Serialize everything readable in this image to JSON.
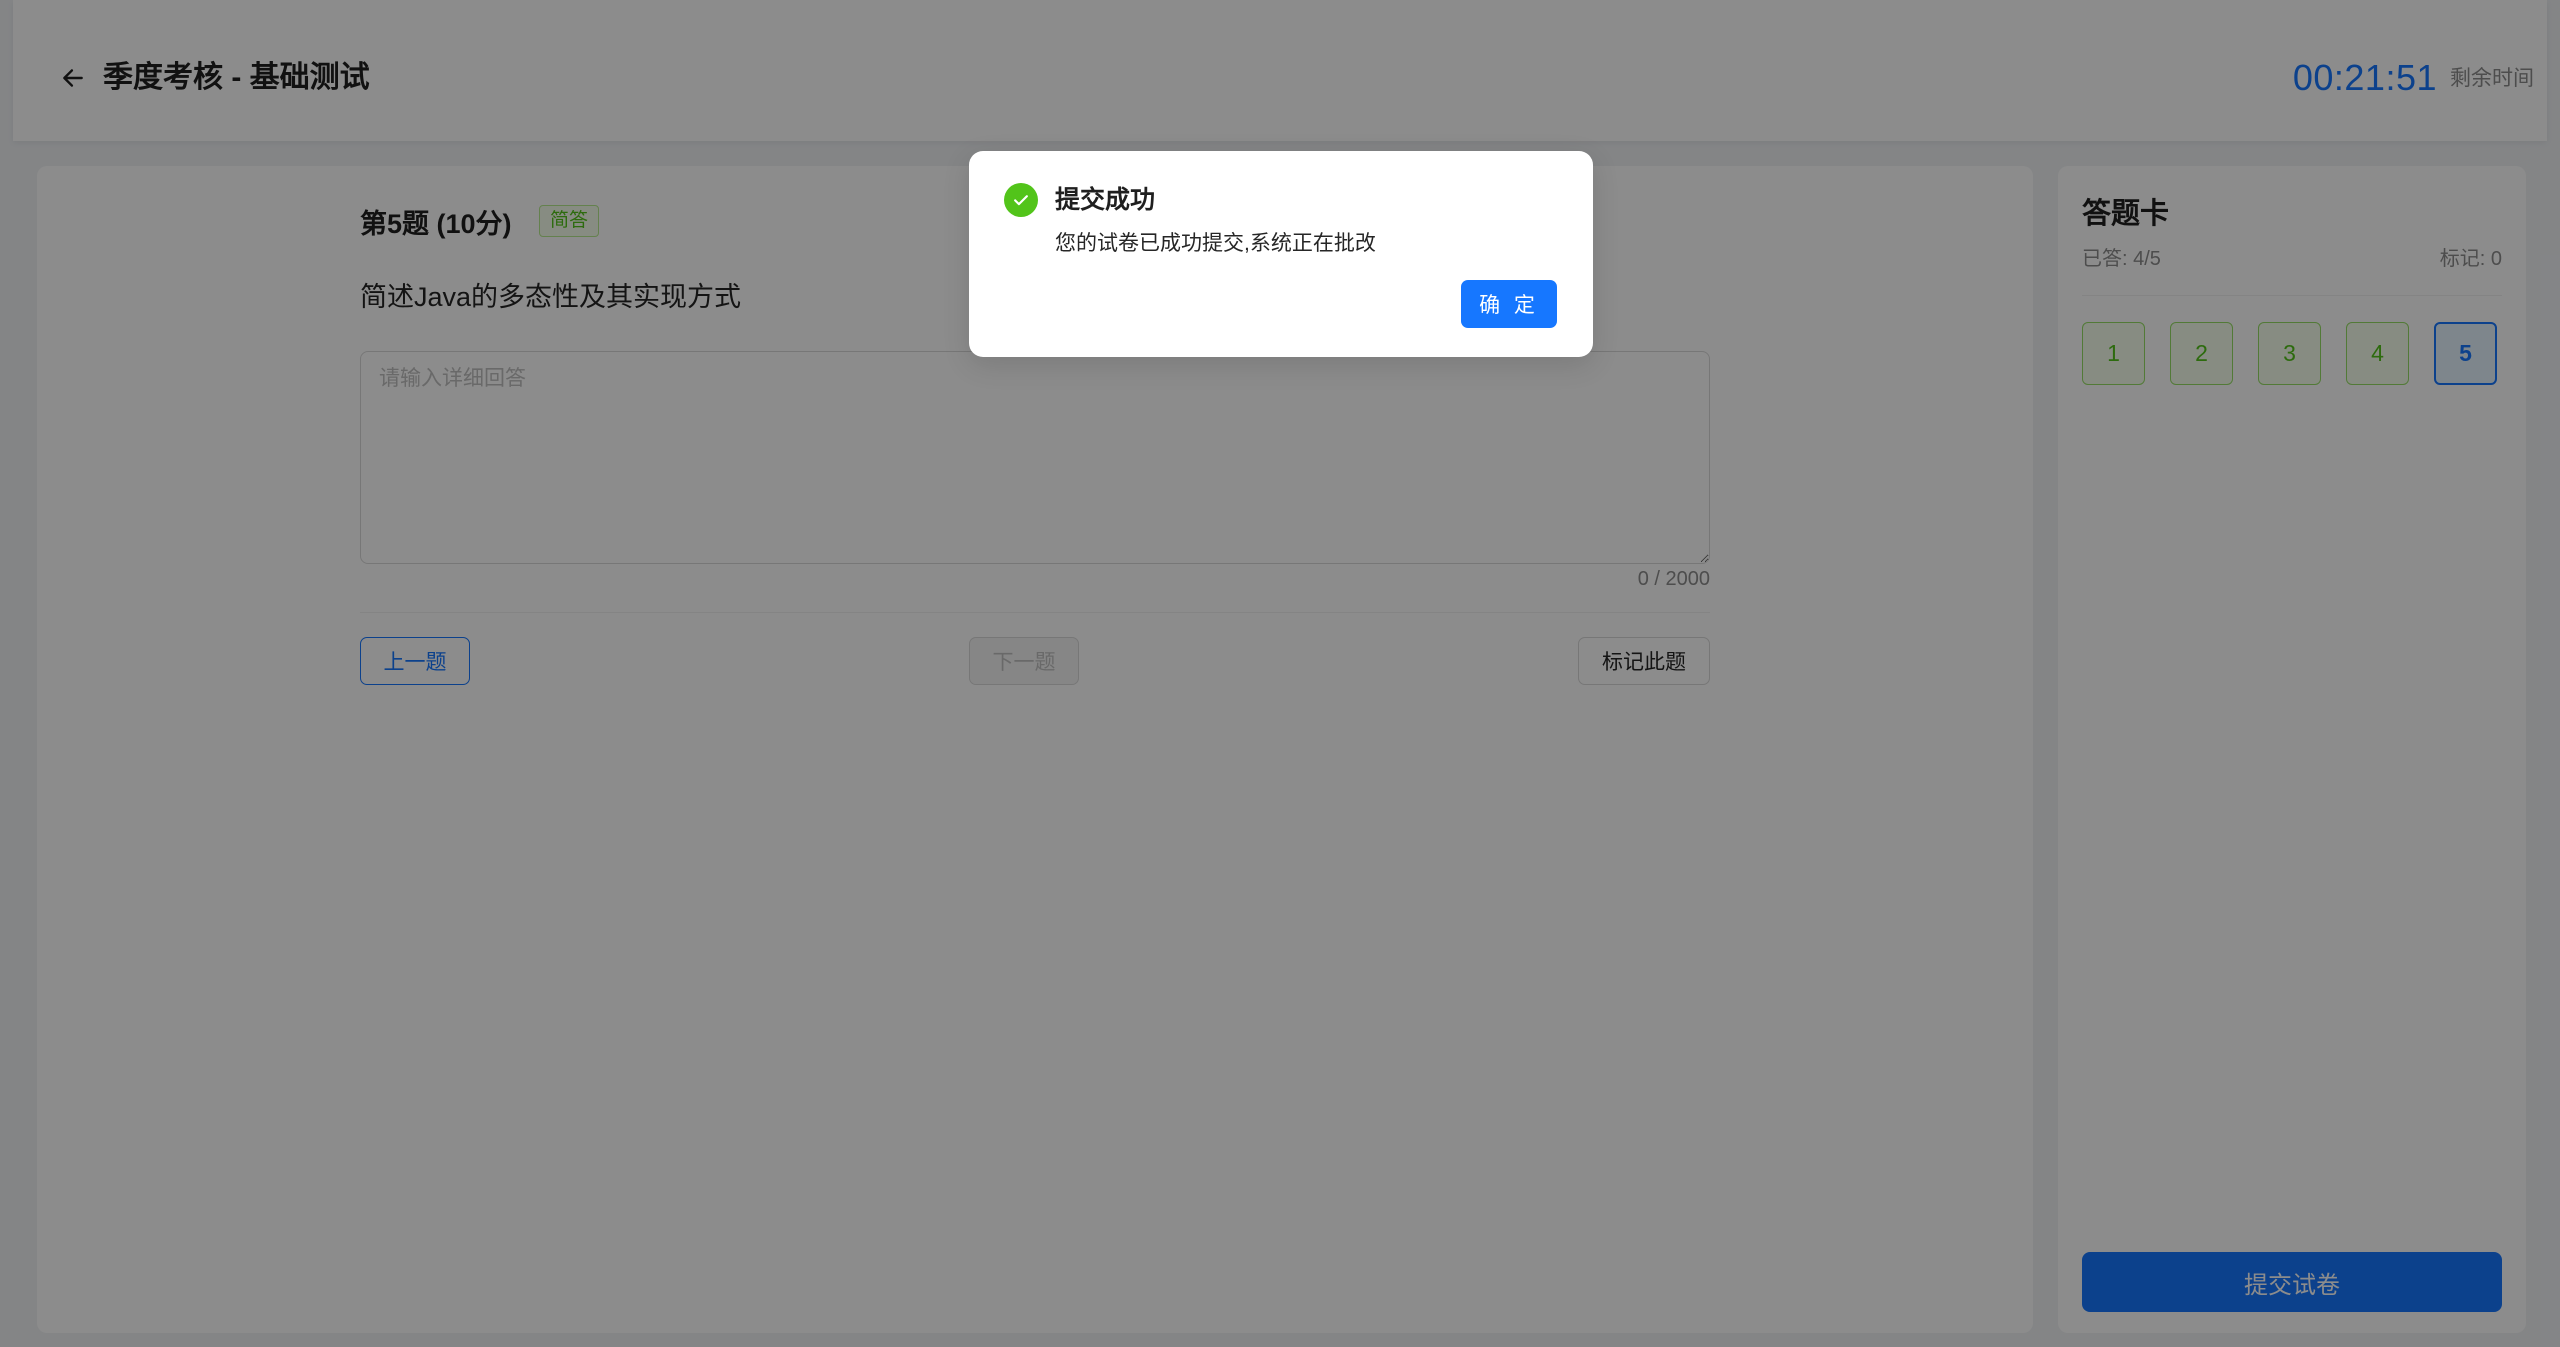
{
  "header": {
    "title": "季度考核 - 基础测试",
    "timer": "00:21:51",
    "timer_label": "剩余时间"
  },
  "question": {
    "title": "第5题 (10分)",
    "type_tag": "简答",
    "text": "简述Java的多态性及其实现方式",
    "answer_value": "",
    "answer_placeholder": "请输入详细回答",
    "char_count": "0 / 2000"
  },
  "nav": {
    "prev_label": "上一题",
    "next_label": "下一题",
    "mark_label": "标记此题"
  },
  "answer_card": {
    "title": "答题卡",
    "answered": "已答: 4/5",
    "marked": "标记: 0",
    "questions": [
      "1",
      "2",
      "3",
      "4",
      "5"
    ],
    "submit_label": "提交试卷"
  },
  "modal": {
    "title": "提交成功",
    "content": "您的试卷已成功提交,系统正在批改",
    "ok_label": "确 定"
  },
  "colors": {
    "primary": "#1677ff",
    "success": "#52c41a"
  }
}
